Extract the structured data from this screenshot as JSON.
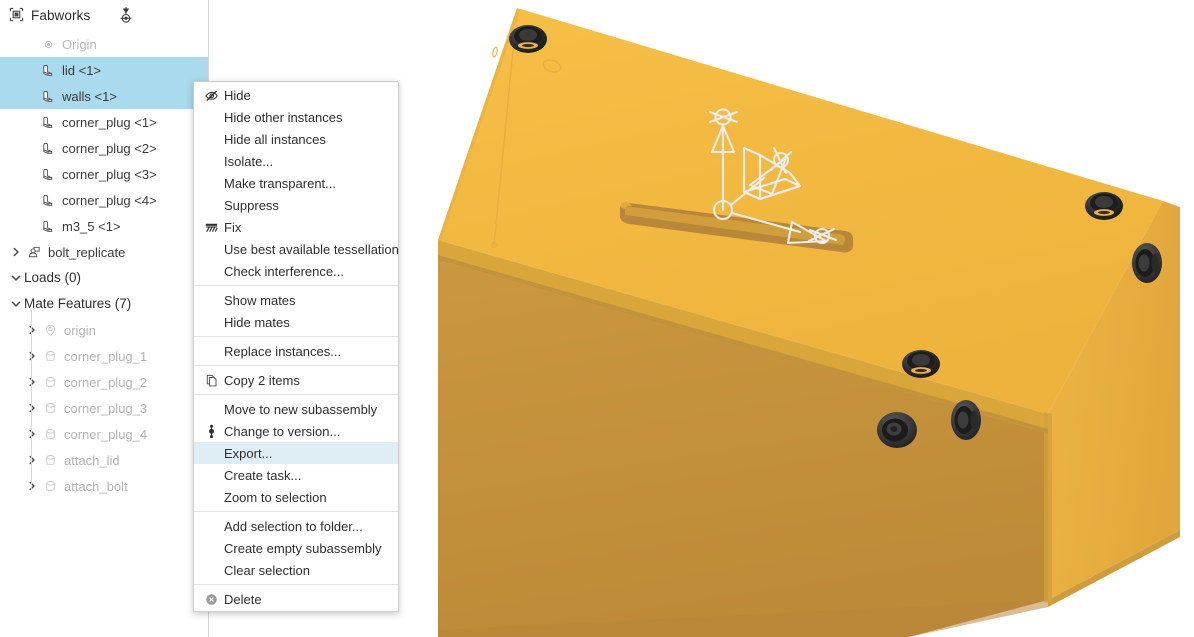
{
  "app": {
    "title": "Fabworks",
    "title_icon": "assembly-icon",
    "header_icon": "mate-connector-icon",
    "canvas_bg": "#ffffff"
  },
  "tree": {
    "header_label": "Fabworks",
    "items": [
      {
        "label": "Origin",
        "icon": "origin-icon",
        "state": "dim",
        "indent": 1,
        "twisty": ""
      },
      {
        "label": "lid <1>",
        "icon": "part-icon",
        "state": "selected",
        "indent": 1,
        "twisty": ""
      },
      {
        "label": "walls <1>",
        "icon": "part-icon",
        "state": "selected",
        "indent": 1,
        "twisty": ""
      },
      {
        "label": "corner_plug <1>",
        "icon": "part-icon",
        "state": "normal",
        "indent": 1,
        "twisty": ""
      },
      {
        "label": "corner_plug <2>",
        "icon": "part-icon",
        "state": "normal",
        "indent": 1,
        "twisty": ""
      },
      {
        "label": "corner_plug <3>",
        "icon": "part-icon",
        "state": "normal",
        "indent": 1,
        "twisty": ""
      },
      {
        "label": "corner_plug <4>",
        "icon": "part-icon",
        "state": "normal",
        "indent": 1,
        "twisty": ""
      },
      {
        "label": "m3_5 <1>",
        "icon": "part-icon",
        "state": "normal",
        "indent": 1,
        "twisty": ""
      },
      {
        "label": "bolt_replicate",
        "icon": "pattern-icon",
        "state": "normal",
        "indent": 0,
        "twisty": "right"
      },
      {
        "label": "Loads (0)",
        "icon": "",
        "state": "group",
        "indent": 0,
        "twisty": "down"
      },
      {
        "label": "Mate Features (7)",
        "icon": "",
        "state": "group",
        "indent": 0,
        "twisty": "down"
      },
      {
        "label": "origin",
        "icon": "mate-origin-icon",
        "state": "dim",
        "indent": 2,
        "twisty": "right"
      },
      {
        "label": "corner_plug_1",
        "icon": "mate-icon",
        "state": "dim",
        "indent": 2,
        "twisty": "right"
      },
      {
        "label": "corner_plug_2",
        "icon": "mate-icon",
        "state": "dim",
        "indent": 2,
        "twisty": "right"
      },
      {
        "label": "corner_plug_3",
        "icon": "mate-icon",
        "state": "dim",
        "indent": 2,
        "twisty": "right"
      },
      {
        "label": "corner_plug_4",
        "icon": "mate-icon",
        "state": "dim",
        "indent": 2,
        "twisty": "right"
      },
      {
        "label": "attach_lid",
        "icon": "mate-icon",
        "state": "dim",
        "indent": 2,
        "twisty": "right"
      },
      {
        "label": "attach_bolt",
        "icon": "mate-icon",
        "state": "dim",
        "indent": 2,
        "twisty": "right"
      }
    ],
    "selection_color": "#aadaed"
  },
  "context_menu": {
    "highlight_color": "#dfeef5",
    "items": [
      {
        "label": "Hide",
        "icon": "hide-eye-icon",
        "sep_after": false,
        "highlight": false
      },
      {
        "label": "Hide other instances",
        "icon": "",
        "sep_after": false,
        "highlight": false
      },
      {
        "label": "Hide all instances",
        "icon": "",
        "sep_after": false,
        "highlight": false
      },
      {
        "label": "Isolate...",
        "icon": "",
        "sep_after": false,
        "highlight": false
      },
      {
        "label": "Make transparent...",
        "icon": "",
        "sep_after": false,
        "highlight": false
      },
      {
        "label": "Suppress",
        "icon": "",
        "sep_after": false,
        "highlight": false
      },
      {
        "label": "Fix",
        "icon": "fix-ground-icon",
        "sep_after": false,
        "highlight": false
      },
      {
        "label": "Use best available tessellation",
        "icon": "",
        "sep_after": false,
        "highlight": false
      },
      {
        "label": "Check interference...",
        "icon": "",
        "sep_after": true,
        "highlight": false
      },
      {
        "label": "Show mates",
        "icon": "",
        "sep_after": false,
        "highlight": false
      },
      {
        "label": "Hide mates",
        "icon": "",
        "sep_after": true,
        "highlight": false
      },
      {
        "label": "Replace instances...",
        "icon": "",
        "sep_after": true,
        "highlight": false
      },
      {
        "label": "Copy 2 items",
        "icon": "copy-icon",
        "sep_after": true,
        "highlight": false
      },
      {
        "label": "Move to new subassembly",
        "icon": "",
        "sep_after": false,
        "highlight": false
      },
      {
        "label": "Change to version...",
        "icon": "version-icon",
        "sep_after": false,
        "highlight": false
      },
      {
        "label": "Export...",
        "icon": "",
        "sep_after": false,
        "highlight": true
      },
      {
        "label": "Create task...",
        "icon": "",
        "sep_after": false,
        "highlight": false
      },
      {
        "label": "Zoom to selection",
        "icon": "",
        "sep_after": true,
        "highlight": false
      },
      {
        "label": "Add selection to folder...",
        "icon": "",
        "sep_after": false,
        "highlight": false
      },
      {
        "label": "Create empty subassembly",
        "icon": "",
        "sep_after": false,
        "highlight": false
      },
      {
        "label": "Clear selection",
        "icon": "",
        "sep_after": true,
        "highlight": false
      },
      {
        "label": "Delete",
        "icon": "delete-icon",
        "sep_after": false,
        "highlight": false
      }
    ]
  },
  "model": {
    "name": "enclosure-box-assembly",
    "colors": {
      "top_face": "#f2b840",
      "front_face": "#c4913c",
      "right_face": "#e8ae40",
      "lid_rim": "#d9a03a",
      "slot_inner": "#b9873a",
      "bolt_dark": "#262626",
      "bolt_mid": "#3d3d3d",
      "bolt_slot": "#e9b24a",
      "edge_line": "#e2a93f",
      "triad_line": "#e8e8e8"
    },
    "overlay": "mate-connector-triad"
  }
}
